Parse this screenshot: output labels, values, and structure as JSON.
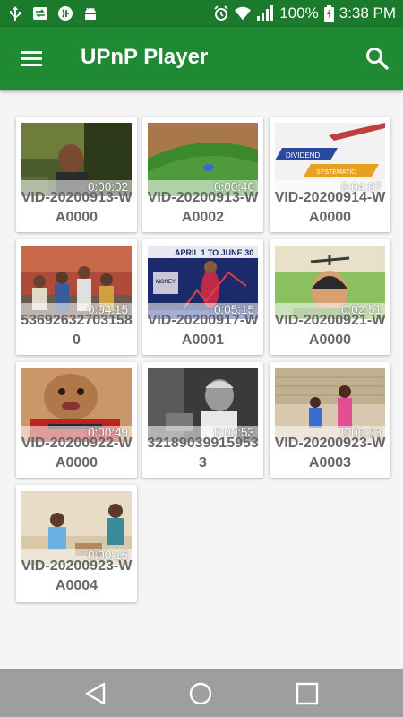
{
  "status_bar": {
    "battery": "100%",
    "time": "3:38 PM",
    "left_icons": [
      "usb-icon",
      "sync-icon",
      "app-notification-icon",
      "android-icon"
    ],
    "right_icons": [
      "alarm-icon",
      "wifi-icon",
      "signal-icon",
      "battery-charging-icon"
    ]
  },
  "app_bar": {
    "title": "UPnP Player",
    "menu_icon": "hamburger-menu-icon",
    "search_icon": "search-icon",
    "color": "#1f8a33"
  },
  "videos": [
    {
      "name": "VID-20200913-WA0000",
      "duration": "0:00:02"
    },
    {
      "name": "VID-20200913-WA0002",
      "duration": "0:00:40"
    },
    {
      "name": "VID-20200914-WA0000",
      "duration": "0:04:07"
    },
    {
      "name": "536926327031580",
      "duration": "0:04:15"
    },
    {
      "name": "VID-20200917-WA0001",
      "duration": "0:05:15"
    },
    {
      "name": "VID-20200921-WA0000",
      "duration": "0:02:51"
    },
    {
      "name": "VID-20200922-WA0000",
      "duration": "0:00:49"
    },
    {
      "name": "321890399159533",
      "duration": "0:00:53"
    },
    {
      "name": "VID-20200923-WA0003",
      "duration": "0:00:23"
    },
    {
      "name": "VID-20200923-WA0004",
      "duration": "0:00:15"
    }
  ],
  "nav_bar": {
    "back_icon": "back-icon",
    "home_icon": "home-icon",
    "recents_icon": "recents-icon"
  }
}
